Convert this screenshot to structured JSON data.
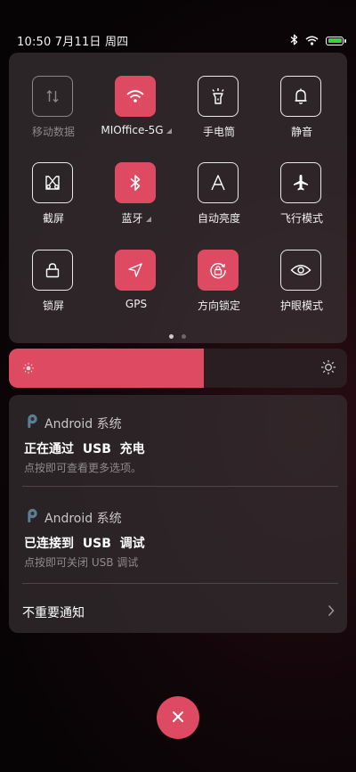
{
  "status": {
    "time": "10:50  7月11日  周四",
    "battery_color": "#38d43a"
  },
  "quick_settings": {
    "tiles": [
      {
        "label": "移动数据",
        "icon": "mobile-data-icon",
        "state": "disabled",
        "dropdown": false
      },
      {
        "label": "MIOffice-5G",
        "icon": "wifi-icon",
        "state": "active",
        "dropdown": true
      },
      {
        "label": "手电筒",
        "icon": "flashlight-icon",
        "state": "off",
        "dropdown": false
      },
      {
        "label": "静音",
        "icon": "bell-icon",
        "state": "off",
        "dropdown": false
      },
      {
        "label": "截屏",
        "icon": "screenshot-icon",
        "state": "off",
        "dropdown": false
      },
      {
        "label": "蓝牙",
        "icon": "bluetooth-icon",
        "state": "active",
        "dropdown": true
      },
      {
        "label": "自动亮度",
        "icon": "auto-brightness-icon",
        "state": "off",
        "dropdown": false
      },
      {
        "label": "飞行模式",
        "icon": "airplane-icon",
        "state": "off",
        "dropdown": false
      },
      {
        "label": "锁屏",
        "icon": "lock-icon",
        "state": "off",
        "dropdown": false
      },
      {
        "label": "GPS",
        "icon": "location-arrow-icon",
        "state": "active",
        "dropdown": false
      },
      {
        "label": "方向锁定",
        "icon": "rotation-lock-icon",
        "state": "active",
        "dropdown": false
      },
      {
        "label": "护眼模式",
        "icon": "eye-icon",
        "state": "off",
        "dropdown": false
      }
    ],
    "page_indicator": {
      "pages": 2,
      "current": 1
    }
  },
  "brightness": {
    "level": 0.575
  },
  "notifications": [
    {
      "app": "Android 系统",
      "title": "正在通过  USB  充电",
      "text": "点按即可查看更多选项。"
    },
    {
      "app": "Android 系统",
      "title": "已连接到  USB  调试",
      "text": "点按即可关闭 USB 调试"
    }
  ],
  "unimportant_label": "不重要通知",
  "colors": {
    "accent": "#dd4a61"
  }
}
